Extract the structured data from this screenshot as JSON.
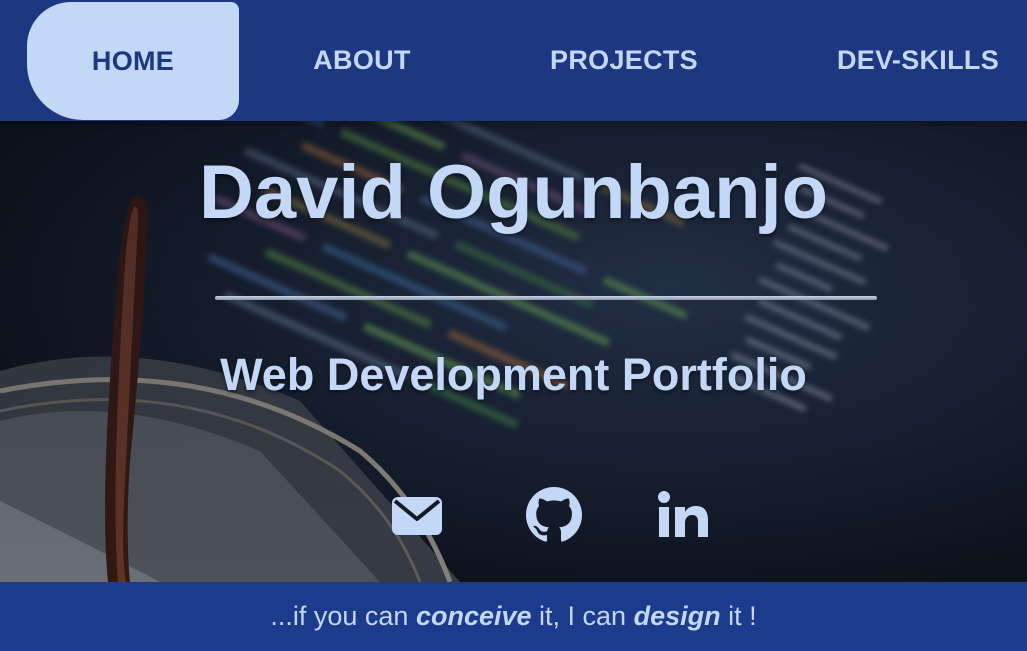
{
  "nav": {
    "items": [
      {
        "label": "HOME",
        "active": true
      },
      {
        "label": "ABOUT",
        "active": false
      },
      {
        "label": "PROJECTS",
        "active": false
      },
      {
        "label": "DEV-SKILLS",
        "active": false
      }
    ]
  },
  "hero": {
    "title": "David Ogunbanjo",
    "subtitle": "Web Development Portfolio",
    "social": [
      {
        "icon": "envelope-icon"
      },
      {
        "icon": "github-icon"
      },
      {
        "icon": "linkedin-icon"
      }
    ]
  },
  "footer": {
    "part1": "...if you can ",
    "emph1": "conceive",
    "part2": " it, I can ",
    "emph2": "design",
    "part3": " it !"
  },
  "colors": {
    "nav_bg": "#1d3880",
    "accent_light": "#c3d7f7",
    "footer_bg": "#1d3b8c"
  }
}
